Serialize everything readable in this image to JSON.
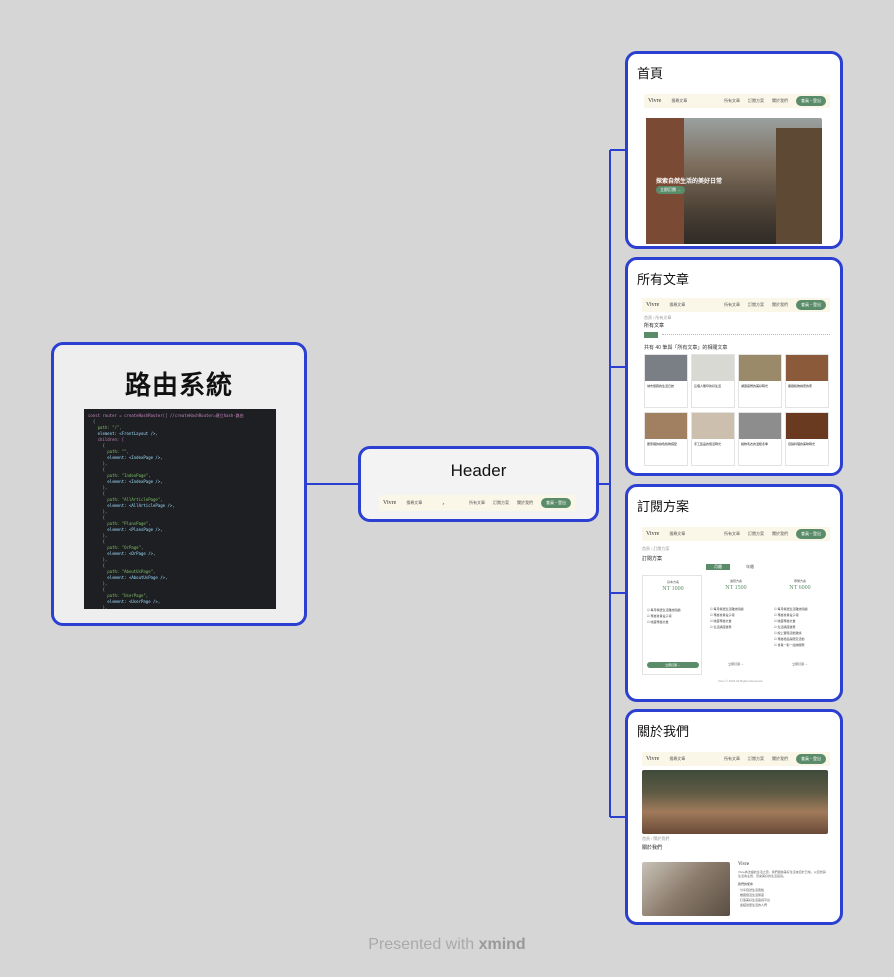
{
  "root": {
    "title": "路由系統",
    "code_lines": [
      "const router = createHashRouter([ //createHashRouter=建立hash-路由",
      "  {",
      "    path: \"/\",",
      "    element: <FrontLayout />,",
      "    children: [",
      "      {",
      "        path: \"\",",
      "        element: <IndexPage />,",
      "      },",
      "      {",
      "        path: \"IndexPage\",",
      "        element: <IndexPage />,",
      "      },",
      "      {",
      "        path: \"AllArticlePage\",",
      "        element: <AllArticlePage />,",
      "      },",
      "      {",
      "        path: \"PlansPage\",",
      "        element: <PlansPage />,",
      "      },",
      "      {",
      "        path: \"OrPage\",",
      "        element: <OrPage />,",
      "      },",
      "      {",
      "        path: \"AboutUsPage\",",
      "        element: <AboutUsPage />,",
      "      },",
      "      {",
      "        path: \"UserPage\",",
      "        element: <UserPage />,",
      "      },",
      "    ]",
      "  }"
    ]
  },
  "header_node": {
    "title": "Header",
    "logo": "Vivre",
    "search": "搜尋文章",
    "links": [
      "所有文章",
      "訂閱方案",
      "關於我們"
    ],
    "user": "會員・登出"
  },
  "pages": [
    {
      "title": "首頁",
      "hero_text": "探索自然生活的美好日常",
      "hero_button": "立即訂閱 →"
    },
    {
      "title": "所有文章",
      "breadcrumb": "首頁 / 所有文章",
      "heading": "所有文章",
      "count_text": "共有 40 筆與「所有文章」的相關文章",
      "cards": [
        {
          "title": "城市慢跑的生活日誌",
          "color": "#7a7f86"
        },
        {
          "title": "這個人無印的好生活",
          "color": "#d9d9d4"
        },
        {
          "title": "湖邊露營的美好時光",
          "color": "#9a8a6a"
        },
        {
          "title": "擁抱植物綠意的家",
          "color": "#8a5a3a"
        },
        {
          "title": "居家裡的綠色植物搭配",
          "color": "#a08060"
        },
        {
          "title": "手工藝品的慢活時光",
          "color": "#cdbfae"
        },
        {
          "title": "織物毛衣的溫暖冬季",
          "color": "#8d8d8d"
        },
        {
          "title": "自製料理的美味時光",
          "color": "#6a3a20"
        }
      ]
    },
    {
      "title": "訂閱方案",
      "breadcrumb": "首頁 / 訂閱方案",
      "heading": "訂閱方案",
      "toggle": [
        "月繳",
        "年繳"
      ],
      "plans": [
        {
          "name": "基本方案",
          "price": "NT 1000",
          "unit": "/月",
          "features": [
            "每月精選生活雜誌閱讀",
            "專屬會員電子報",
            "收藏專屬文章"
          ],
          "button": "立即訂閱 →"
        },
        {
          "name": "進階方案",
          "price": "NT 1500",
          "unit": "/月",
          "features": [
            "每月精選生活雜誌閱讀",
            "專屬會員電子報",
            "收藏專屬文章",
            "生活講座優惠"
          ],
          "button": "立即訂閱 →"
        },
        {
          "name": "尊榮方案",
          "price": "NT 6000",
          "unit": "/年",
          "features": [
            "每月精選生活雜誌閱讀",
            "專屬會員電子報",
            "收藏專屬文章",
            "生活講座優惠",
            "線上實體活動邀請",
            "專屬禮品與限定活動",
            "會員一對一諮詢服務"
          ],
          "button": "立即訂閱 →"
        }
      ],
      "footer": "Vivre © 2024 All Rights Reserved"
    },
    {
      "title": "關於我們",
      "breadcrumb": "首頁 / 關於我們",
      "heading": "關於我們",
      "brand": "Vivre",
      "para": "Vivre為法語的生活之意，我們相信美好生活來自於日常。以自然與生活為主題，帶來美好的生活靈感。",
      "sub": "我們的使命",
      "bullets": [
        "分享自然生活風格",
        "推廣慢活生活態度",
        "打造美好生活靈感平台",
        "連結熱愛生活的人們"
      ]
    }
  ],
  "footer": {
    "prefix": "Presented with",
    "brand": "xmind"
  },
  "colors": {
    "border": "#2b3fd0",
    "line": "#2b3fd0",
    "accent_green": "#5b8c6a",
    "header_bg": "#fbf7e8"
  }
}
